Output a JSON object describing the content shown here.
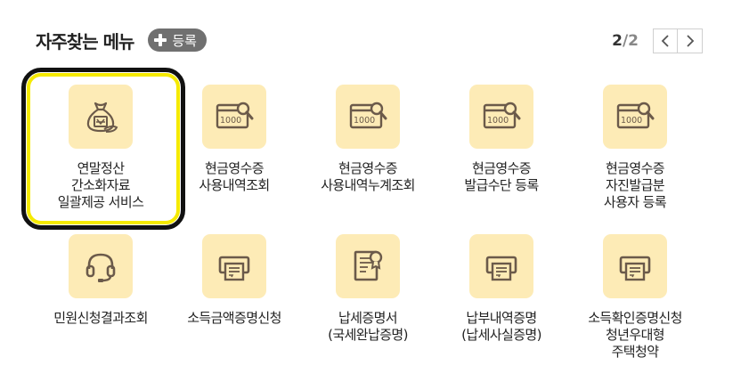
{
  "header": {
    "title": "자주찾는 메뉴",
    "register_label": "등록"
  },
  "pager": {
    "current": "2",
    "separator": "/",
    "total": "2"
  },
  "menu": {
    "items": [
      {
        "label": "연말정산\n간소화자료\n일괄제공 서비스",
        "icon": "money-bag-icon"
      },
      {
        "label": "현금영수증\n사용내역조회",
        "icon": "receipt-search-icon"
      },
      {
        "label": "현금영수증\n사용내역누계조회",
        "icon": "receipt-search-icon"
      },
      {
        "label": "현금영수증\n발급수단 등록",
        "icon": "receipt-search-icon"
      },
      {
        "label": "현금영수증\n자진발급분\n사용자 등록",
        "icon": "receipt-search-icon"
      },
      {
        "label": "민원신청결과조회",
        "icon": "headset-icon"
      },
      {
        "label": "소득금액증명신청",
        "icon": "printer-icon"
      },
      {
        "label": "납세증명서\n(국세완납증명)",
        "icon": "certificate-icon"
      },
      {
        "label": "납부내역증명\n(납세사실증명)",
        "icon": "printer-icon"
      },
      {
        "label": "소득확인증명신청\n청년우대형\n주택청약",
        "icon": "printer-icon"
      }
    ]
  },
  "colors": {
    "icon_bg": "#fdebb6",
    "icon_stroke": "#6b5a4a",
    "highlight_inner": "#f5ea00",
    "highlight_outer": "#111111",
    "button_bg": "#707070"
  }
}
